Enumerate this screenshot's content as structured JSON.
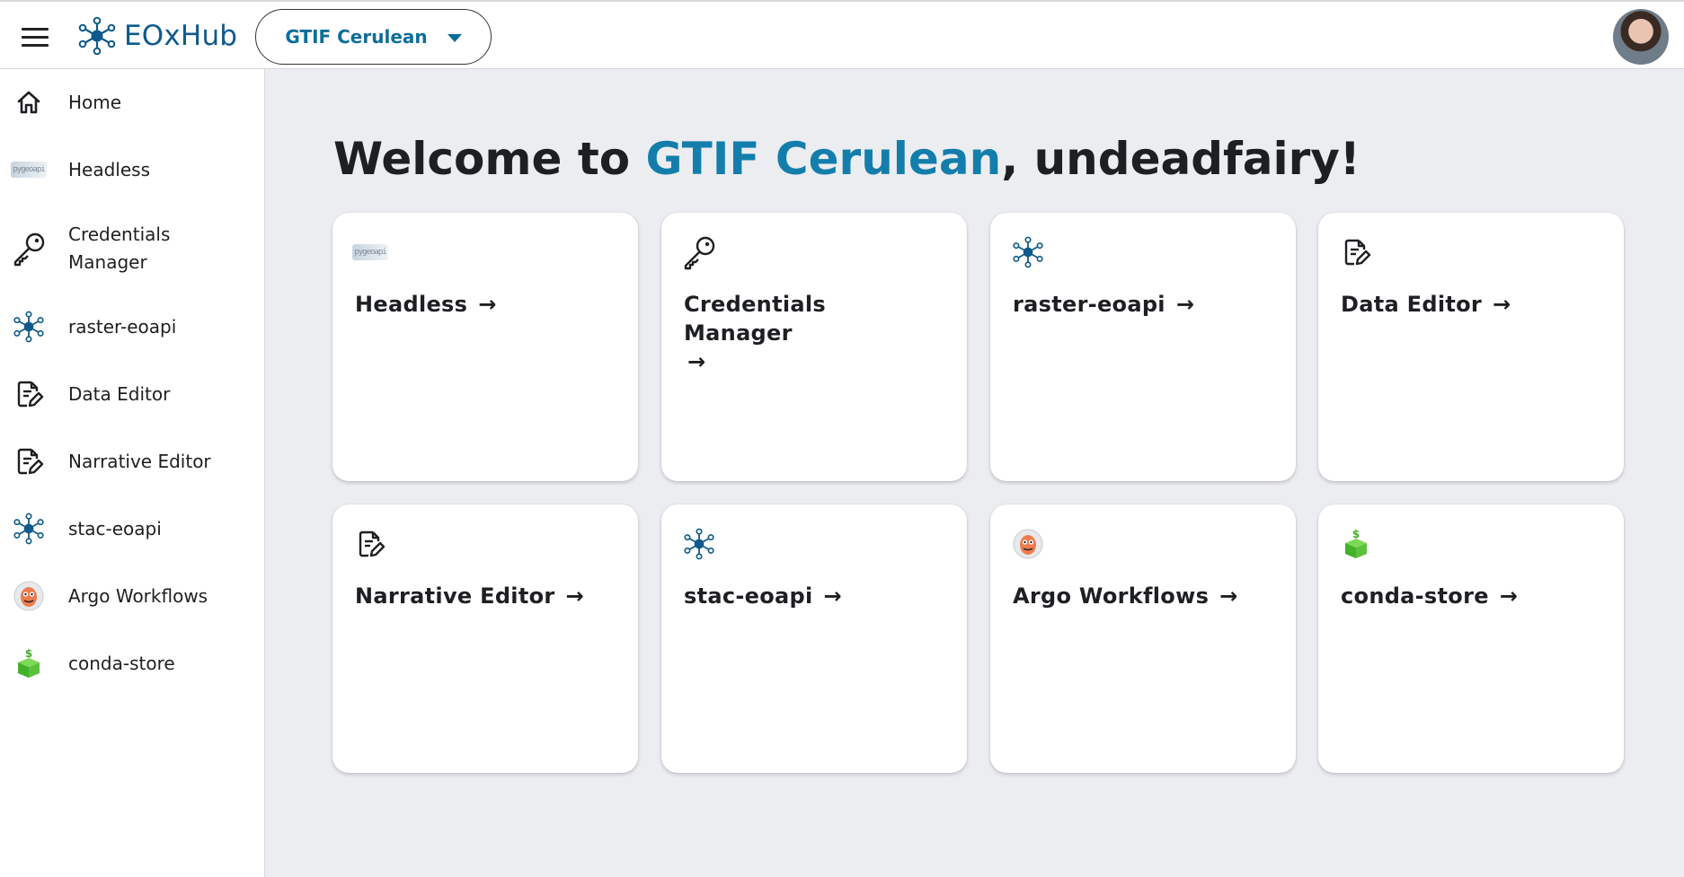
{
  "app": {
    "brand": "EOxHub",
    "space": "GTIF Cerulean"
  },
  "colors": {
    "brand_blue": "#0f5a8a",
    "accent": "#137eab",
    "background": "#ecedf1",
    "conda_green": "#43b02a",
    "argo_orange": "#ef7b4d"
  },
  "sidebar": {
    "items": [
      {
        "label": "Home",
        "icon": "home-icon"
      },
      {
        "label": "Headless",
        "icon": "headless-logo-icon"
      },
      {
        "label": "Credentials\nManager",
        "icon": "key-icon"
      },
      {
        "label": "raster-eoapi",
        "icon": "network-node-icon"
      },
      {
        "label": "Data Editor",
        "icon": "document-edit-icon"
      },
      {
        "label": "Narrative Editor",
        "icon": "document-edit-icon"
      },
      {
        "label": "stac-eoapi",
        "icon": "network-node-icon"
      },
      {
        "label": "Argo Workflows",
        "icon": "argo-octopus-icon"
      },
      {
        "label": "conda-store",
        "icon": "conda-store-icon"
      }
    ]
  },
  "main": {
    "welcome_prefix": "Welcome to ",
    "welcome_space": "GTIF Cerulean",
    "welcome_suffix": ", undeadfairy!",
    "cards": [
      {
        "title": "Headless",
        "arrow": "→",
        "icon": "headless-logo-icon"
      },
      {
        "title": "Credentials Manager",
        "arrow": "→",
        "icon": "key-icon"
      },
      {
        "title": "raster-eoapi",
        "arrow": "→",
        "icon": "network-node-icon"
      },
      {
        "title": "Data Editor",
        "arrow": "→",
        "icon": "document-edit-icon"
      },
      {
        "title": "Narrative Editor",
        "arrow": "→",
        "icon": "document-edit-icon"
      },
      {
        "title": "stac-eoapi",
        "arrow": "→",
        "icon": "network-node-icon"
      },
      {
        "title": "Argo Workflows",
        "arrow": "→",
        "icon": "argo-octopus-icon"
      },
      {
        "title": "conda-store",
        "arrow": "→",
        "icon": "conda-store-icon"
      }
    ]
  }
}
